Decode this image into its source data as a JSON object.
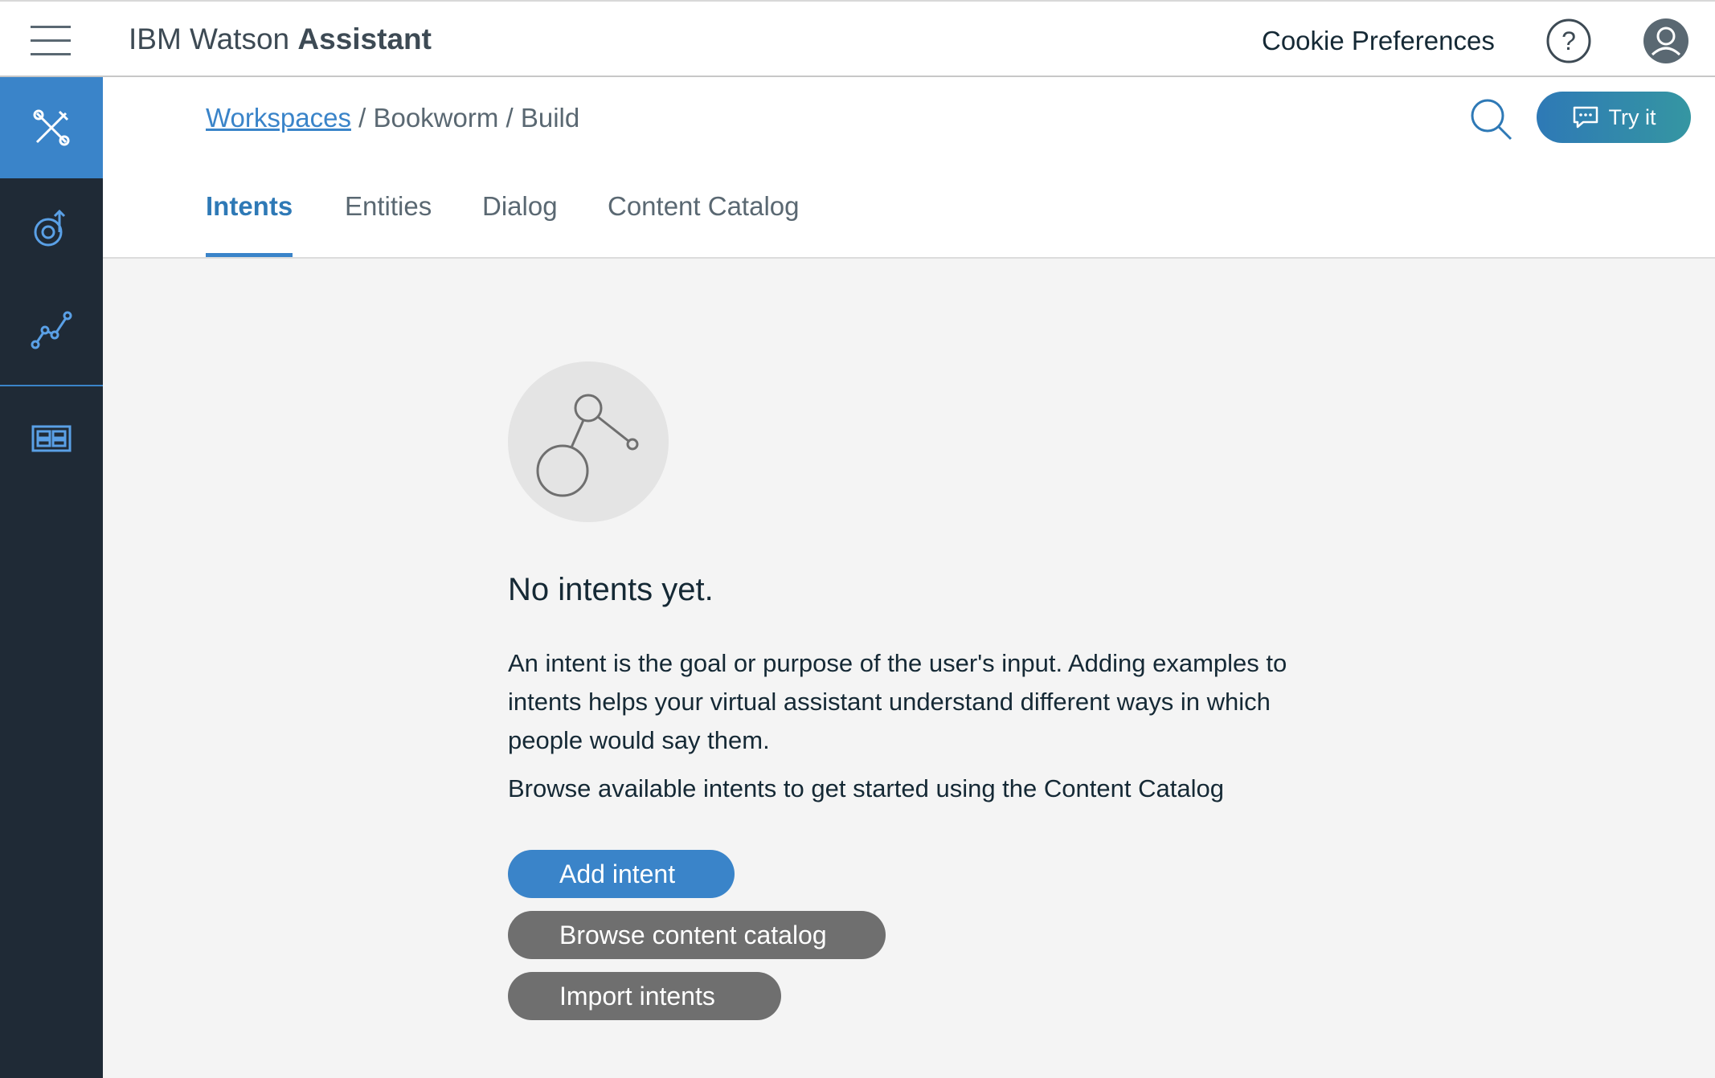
{
  "header": {
    "brand_prefix": "IBM Watson",
    "brand_bold": "Assistant",
    "cookie_preferences": "Cookie Preferences"
  },
  "sidebar": {
    "items": [
      {
        "icon": "tools-icon",
        "active": true
      },
      {
        "icon": "improve-icon",
        "active": false
      },
      {
        "icon": "analytics-icon",
        "active": false
      },
      {
        "icon": "deploy-icon",
        "active": false
      }
    ]
  },
  "breadcrumb": {
    "workspaces": "Workspaces",
    "rest": "/ Bookworm / Build"
  },
  "try_it_label": "Try it",
  "tabs": [
    {
      "label": "Intents",
      "active": true
    },
    {
      "label": "Entities",
      "active": false
    },
    {
      "label": "Dialog",
      "active": false
    },
    {
      "label": "Content Catalog",
      "active": false
    }
  ],
  "empty_state": {
    "title": "No intents yet.",
    "description": "An intent is the goal or purpose of the user's input. Adding examples to intents helps your virtual assistant understand different ways in which people would say them.",
    "browse_hint": "Browse available intents to get started using the Content Catalog"
  },
  "buttons": {
    "add_intent": "Add intent",
    "browse_catalog": "Browse content catalog",
    "import_intents": "Import intents"
  },
  "colors": {
    "accent": "#3a84c9",
    "sidebar": "#1f2a36",
    "secondary_button": "#6f6f6f"
  }
}
